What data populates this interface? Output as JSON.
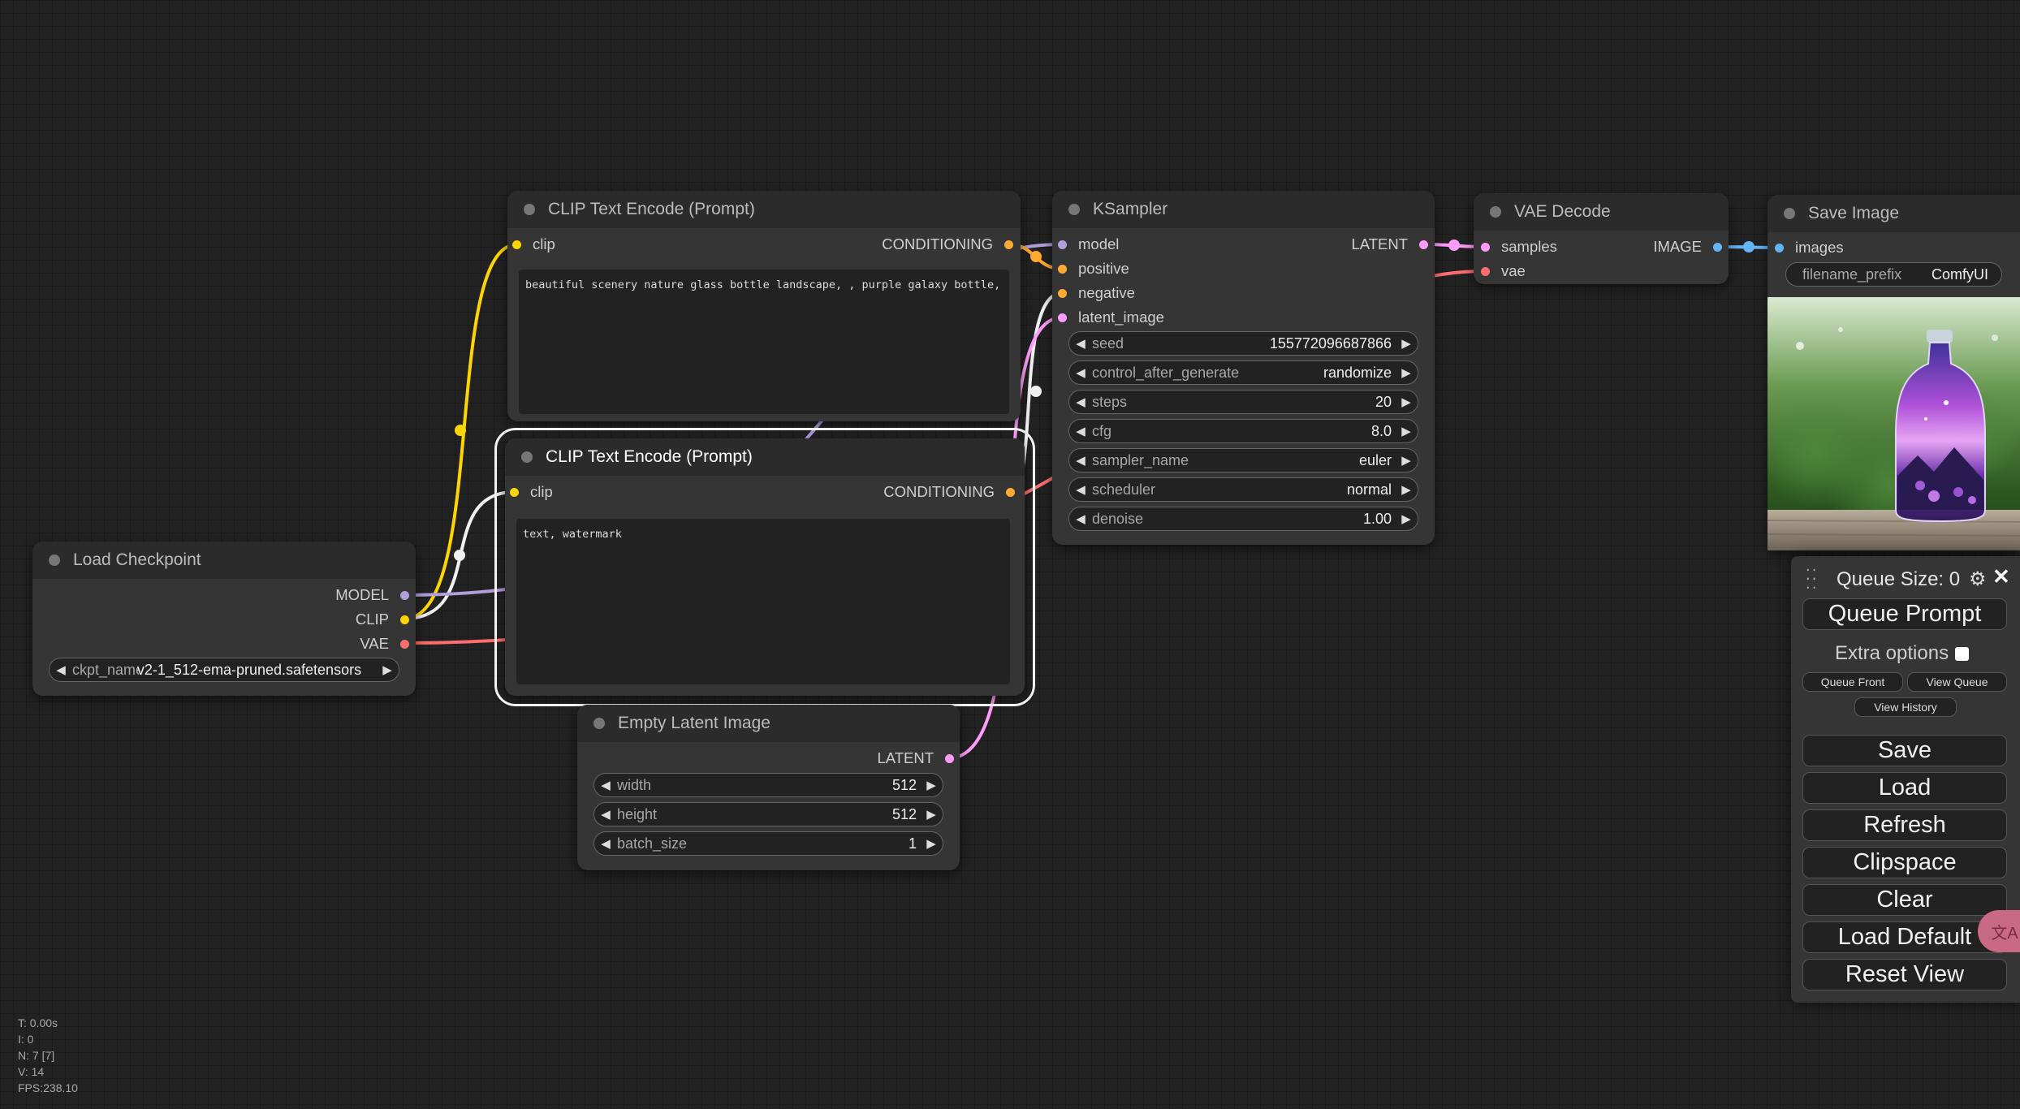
{
  "nodes": {
    "clip_pos": {
      "title": "CLIP Text Encode (Prompt)",
      "input": "clip",
      "output": "CONDITIONING",
      "text": "beautiful scenery nature glass bottle landscape, , purple galaxy bottle,"
    },
    "clip_neg": {
      "title": "CLIP Text Encode (Prompt)",
      "input": "clip",
      "output": "CONDITIONING",
      "text": "text, watermark"
    },
    "ksampler": {
      "title": "KSampler",
      "inputs": [
        "model",
        "positive",
        "negative",
        "latent_image"
      ],
      "output": "LATENT",
      "widgets": [
        {
          "label": "seed",
          "value": "155772096687866"
        },
        {
          "label": "control_after_generate",
          "value": "randomize"
        },
        {
          "label": "steps",
          "value": "20"
        },
        {
          "label": "cfg",
          "value": "8.0"
        },
        {
          "label": "sampler_name",
          "value": "euler"
        },
        {
          "label": "scheduler",
          "value": "normal"
        },
        {
          "label": "denoise",
          "value": "1.00"
        }
      ]
    },
    "vae_decode": {
      "title": "VAE Decode",
      "inputs": [
        "samples",
        "vae"
      ],
      "output": "IMAGE"
    },
    "save_image": {
      "title": "Save Image",
      "input": "images",
      "widget": {
        "label": "filename_prefix",
        "value": "ComfyUI"
      }
    },
    "load_checkpoint": {
      "title": "Load Checkpoint",
      "outputs": [
        "MODEL",
        "CLIP",
        "VAE"
      ],
      "widget": {
        "label": "ckpt_name",
        "value": "v2-1_512-ema-pruned.safetensors"
      }
    },
    "empty_latent": {
      "title": "Empty Latent Image",
      "output": "LATENT",
      "widgets": [
        {
          "label": "width",
          "value": "512"
        },
        {
          "label": "height",
          "value": "512"
        },
        {
          "label": "batch_size",
          "value": "1"
        }
      ]
    }
  },
  "menu": {
    "queue_size": "Queue Size: 0",
    "queue_prompt": "Queue Prompt",
    "extra_options": "Extra options",
    "queue_front": "Queue Front",
    "view_queue": "View Queue",
    "view_history": "View History",
    "save": "Save",
    "load": "Load",
    "refresh": "Refresh",
    "clipspace": "Clipspace",
    "clear": "Clear",
    "load_default": "Load Default",
    "reset_view": "Reset View"
  },
  "stats": {
    "t": "T: 0.00s",
    "i": "I: 0",
    "n": "N: 7 [7]",
    "v": "V: 14",
    "fps": "FPS:238.10"
  },
  "colors": {
    "model": "#b39ddb",
    "clip": "#ffd500",
    "vae": "#ff6e6e",
    "conditioning": "#ffa931",
    "latent": "#ff9cf9",
    "image": "#64b5f6",
    "canvas": "#222222",
    "node_body": "#353535"
  }
}
